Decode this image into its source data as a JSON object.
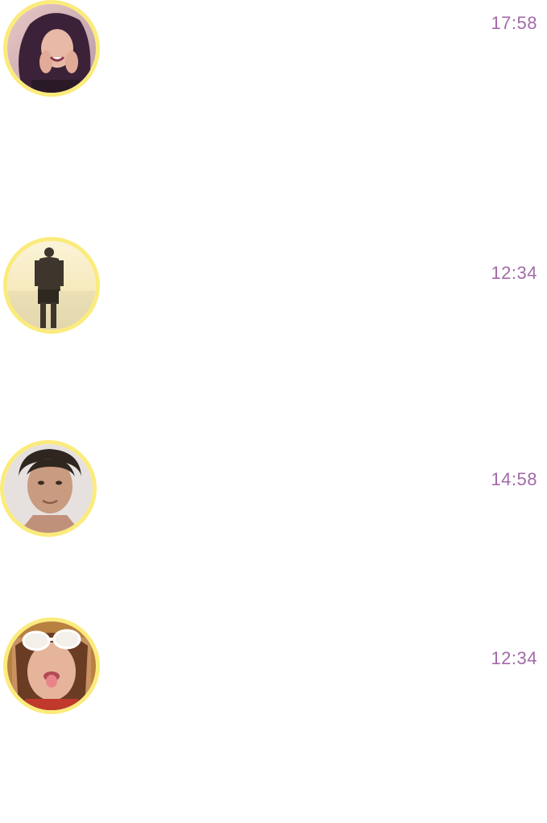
{
  "theme": {
    "timestamp_color": "#a36aa8",
    "avatar_ring_color": "#fbeb7c",
    "background": "#ffffff"
  },
  "chats": [
    {
      "avatar_icon": "avatar-woman-smiling",
      "time": "17:58"
    },
    {
      "avatar_icon": "avatar-man-beach-silhouette",
      "time": "12:34"
    },
    {
      "avatar_icon": "avatar-man-portrait",
      "time": "14:58"
    },
    {
      "avatar_icon": "avatar-woman-sunglasses",
      "time": "12:34"
    }
  ]
}
